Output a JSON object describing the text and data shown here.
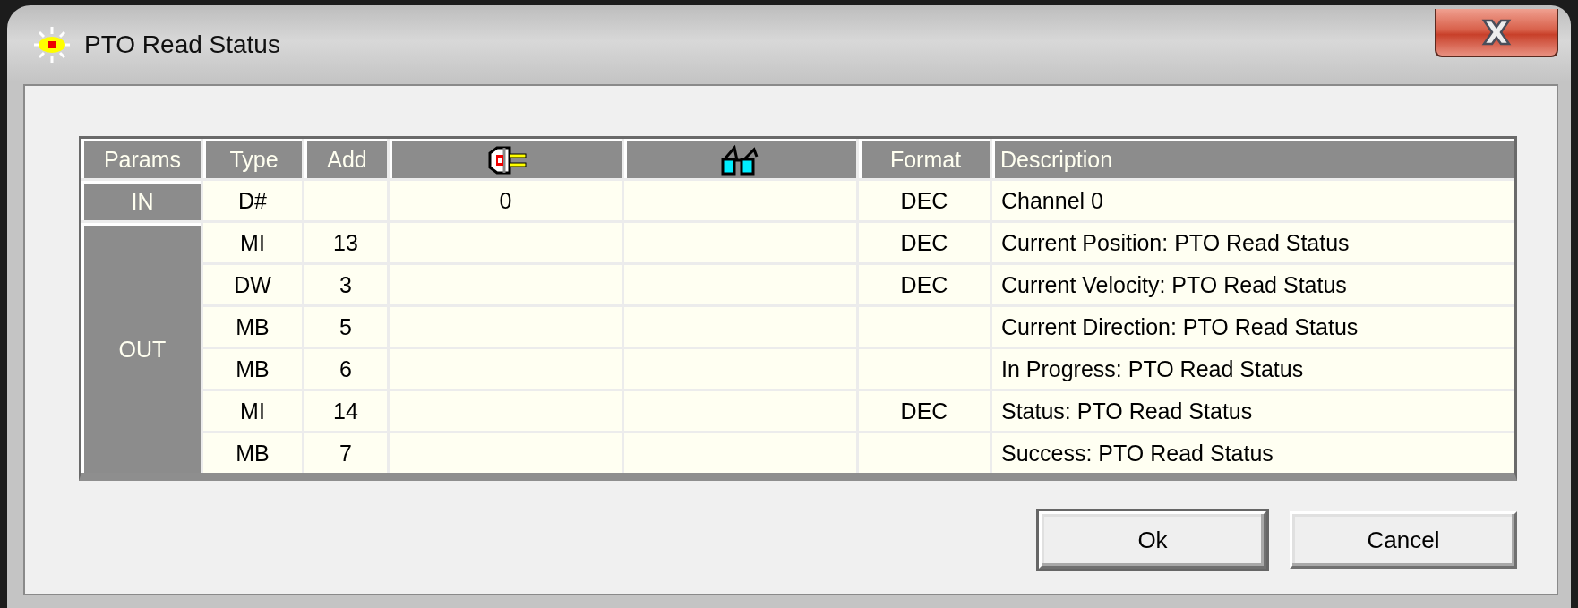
{
  "window": {
    "title": "PTO Read Status"
  },
  "table": {
    "columns": [
      {
        "kind": "text",
        "label": "Params"
      },
      {
        "kind": "text",
        "label": "Type"
      },
      {
        "kind": "text",
        "label": "Add"
      },
      {
        "kind": "icon"
      },
      {
        "kind": "icon"
      },
      {
        "kind": "text",
        "label": "Format"
      },
      {
        "kind": "text",
        "label": "Description"
      }
    ],
    "groups": [
      {
        "label": "IN",
        "rows": [
          {
            "type": "D#",
            "column_4": "0",
            "format": "DEC",
            "description": "Channel 0"
          }
        ]
      },
      {
        "label": "OUT",
        "rows": [
          {
            "type": "MI",
            "add": "13",
            "format": "DEC",
            "description": "Current Position: PTO Read Status"
          },
          {
            "type": "DW",
            "add": "3",
            "format": "DEC",
            "description": "Current Velocity: PTO Read Status"
          },
          {
            "type": "MB",
            "add": "5",
            "description": "Current Direction: PTO Read Status"
          },
          {
            "type": "MB",
            "add": "6",
            "description": "In Progress: PTO Read Status"
          },
          {
            "type": "MI",
            "add": "14",
            "format": "DEC",
            "description": "Status: PTO Read Status"
          },
          {
            "type": "MB",
            "add": "7",
            "description": "Success: PTO Read Status"
          }
        ]
      }
    ]
  },
  "buttons": [
    {
      "label": "Ok",
      "default": true
    },
    {
      "label": "Cancel",
      "default": false
    }
  ]
}
